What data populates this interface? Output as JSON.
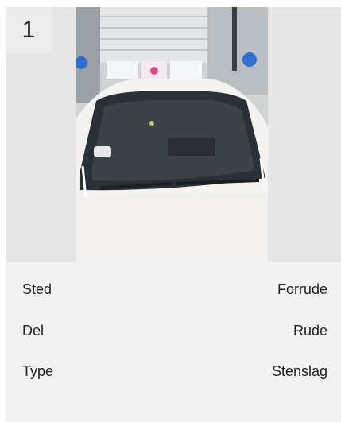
{
  "card": {
    "number": "1"
  },
  "details": {
    "rows": [
      {
        "label": "Sted",
        "value": "Forrude"
      },
      {
        "label": "Del",
        "value": "Rude"
      },
      {
        "label": "Type",
        "value": "Stenslag"
      }
    ]
  },
  "colors": {
    "card_bg": "#f2f2f2",
    "photo_bg": "#e6e6e6",
    "text": "#222222"
  }
}
